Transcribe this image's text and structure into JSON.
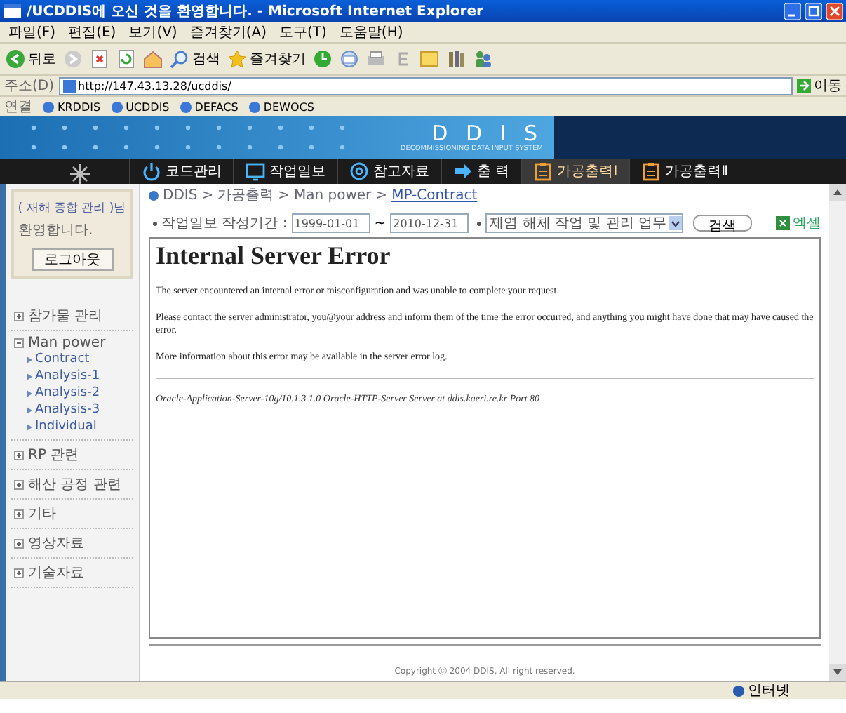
{
  "window": {
    "title": "/UCDDIS에 오신 것을 환영합니다. - Microsoft Internet Explorer"
  },
  "menu": [
    "파일(F)",
    "편집(E)",
    "보기(V)",
    "즐겨찾기(A)",
    "도구(T)",
    "도움말(H)"
  ],
  "toolbar": [
    {
      "label": "뒤로"
    },
    {
      "label": "검색"
    },
    {
      "label": "즐겨찾기"
    }
  ],
  "address": {
    "label": "주소(D)",
    "value": "http://147.43.13.28/ucddis/",
    "go": "이동"
  },
  "links": {
    "label": "연결",
    "items": [
      "KRDDIS",
      "UCDDIS",
      "DEFACS",
      "DEWOCS"
    ]
  },
  "banner": {
    "logo": "D D I S",
    "subtitle": "DECOMMISSIONING DATA INPUT SYSTEM"
  },
  "nav": [
    {
      "label": "코드관리",
      "kind": "power",
      "selected": false
    },
    {
      "label": "작업일보",
      "kind": "screen",
      "selected": false
    },
    {
      "label": "참고자료",
      "kind": "at",
      "selected": false
    },
    {
      "label": "출 력",
      "kind": "arrow",
      "selected": false
    },
    {
      "label": "가공출력Ⅰ",
      "kind": "clipboard",
      "selected": true
    },
    {
      "label": "가공출력Ⅱ",
      "kind": "clipboard",
      "selected": false
    }
  ],
  "sidebar": {
    "user": "( 재해 종합 관리 )님",
    "greeting": "환영합니다.",
    "logout": "로그아웃",
    "items": [
      {
        "label": "참가물 관리",
        "expanded": false
      },
      {
        "label": "Man power",
        "expanded": true,
        "children": [
          "Contract",
          "Analysis-1",
          "Analysis-2",
          "Analysis-3",
          "Individual"
        ]
      },
      {
        "label": "RP 관련",
        "expanded": false
      },
      {
        "label": "해산 공정 관련",
        "expanded": false
      },
      {
        "label": "기타",
        "expanded": false
      },
      {
        "label": "영상자료",
        "expanded": false
      },
      {
        "label": "기술자료",
        "expanded": false
      }
    ]
  },
  "breadcrumb": {
    "separator": ">",
    "items": [
      "DDIS",
      "가공출력",
      "Man power",
      "MP-Contract"
    ]
  },
  "filter": {
    "label": "작업일보 작성기간 :",
    "from": "1999-01-01",
    "dash": "~",
    "to": "2010-12-31",
    "category": "제염 해체 작업 및 관리 업무",
    "search": "검색",
    "excel": "엑셀"
  },
  "error_page": {
    "heading": "Internal Server Error",
    "paragraphs": [
      "The server encountered an internal error or misconfiguration and was unable to complete your request.",
      "Please contact the server administrator, you@your address and inform them of the time the error occurred, and anything you might have done that may have caused the error.",
      "More information about this error may be available in the server error log."
    ],
    "signature": "Oracle-Application-Server-10g/10.1.3.1.0 Oracle-HTTP-Server Server at ddis.kaeri.re.kr Port 80"
  },
  "footer": "Copyright ⓒ 2004 DDIS, All right reserved.",
  "status_bar": {
    "zone": "인터넷"
  }
}
